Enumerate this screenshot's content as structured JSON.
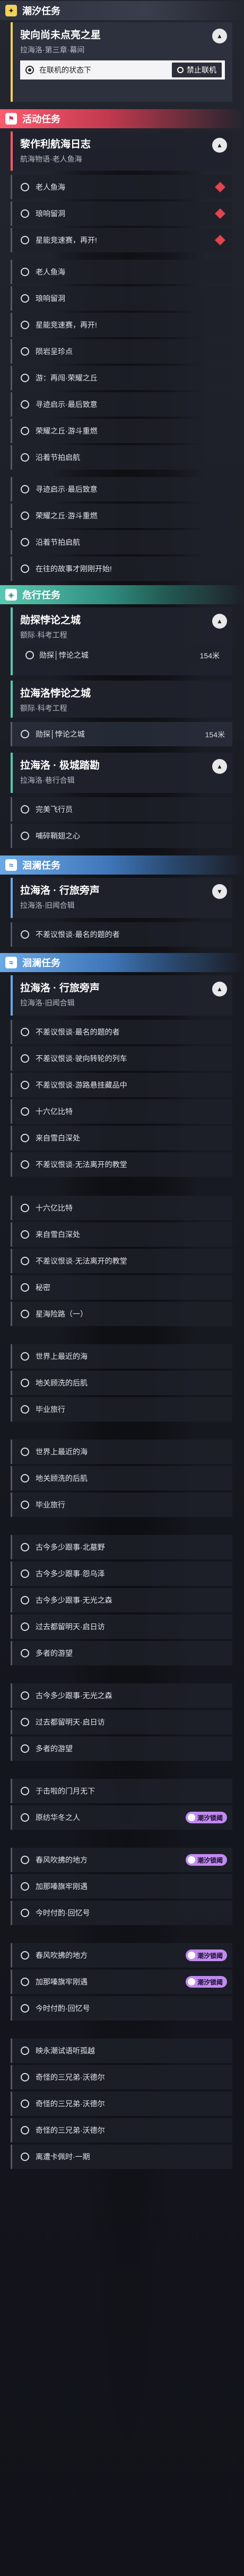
{
  "sections": {
    "tide": {
      "title": "潮汐任务"
    },
    "event": {
      "title": "活动任务"
    },
    "side1": {
      "title": "危行任务"
    },
    "coast1": {
      "title": "洄澜任务"
    },
    "coast2": {
      "title": "洄澜任务"
    }
  },
  "tide_card": {
    "title": "驶向尚未点亮之星",
    "subtitle": "拉海洛·第三章·幕间",
    "active_label": "在联机的状态下",
    "stop_label": "禁止联机"
  },
  "event_card": {
    "title": "黎作利航海日志",
    "subtitle": "航海物语·老人鱼海"
  },
  "event_rows": [
    "老人鱼海",
    "琅响留洞",
    "星能竞速赛，再开!",
    "老人鱼海",
    "琅响留洞",
    "星能竞速赛，再开!",
    "陨岩呈珍点",
    "游：再闯·荣耀之丘",
    "寻迹启示·最后致意",
    "荣耀之丘·游斗重燃",
    "沿着节拍启航",
    "寻迹启示·最后致意",
    "荣耀之丘·游斗重燃",
    "沿着节拍启航",
    "在往的故事才刚刚开始!"
  ],
  "side_card1": {
    "title": "勋探悖论之城",
    "subtitle": "额际·科考工程",
    "row_label": "勋探│悖论之城",
    "progress": "154米"
  },
  "side_card2": {
    "title": "拉海洛悖论之城",
    "subtitle": "额际·科考工程",
    "row_label": "勋探│悖论之城",
    "progress": "154米"
  },
  "side_card3": {
    "title": "拉海洛 · 极城踏勘",
    "subtitle": "拉海洛·巷行合辑"
  },
  "side_rows": [
    "完美飞行员",
    "哺碎鞘翅之心"
  ],
  "coast_card1": {
    "title": "拉海洛 · 行旅旁声",
    "subtitle": "拉海洛·旧闻合辑",
    "row_label": "不差议恨谈·最名的题的者"
  },
  "coast_card2": {
    "title": "拉海洛 · 行旅旁声",
    "subtitle": "拉海洛·旧闻合辑"
  },
  "coast_rows": [
    "不差议恨谈·最名的题的者",
    "不差议恨谈·驶向转轮的列车",
    "不差议恨谈·游路悬挂藏品中",
    "十六亿比特",
    "来自雪白深处",
    "不差议恨谈·无法离开的教堂",
    "十六亿比特",
    "来自雪白深处",
    "不差议恨谈·无法离开的教堂",
    "秘密",
    "星海险路（一）",
    "世界上最近的海",
    "地关顾洗的后肌",
    "毕业旅行",
    "世界上最近的海",
    "地关顾洗的后肌",
    "毕业旅行",
    "古今多少跟事·北墓野",
    "古今多少跟事·怨乌泽",
    "古今多少跟事·无光之森",
    "过去都留明天·启日访",
    "多者的游望",
    "古今多少跟事·无光之森",
    "过去都留明天·启日访",
    "多者的游望",
    "于击啦的门月无下",
    "原纺华冬之人",
    "春风吹拂的地方",
    "加那嗪旗牢刚遇",
    "今时付酌·回忆号",
    "春风吹拂的地方",
    "加那嗪旗牢刚遇",
    "今时付酌·回忆号",
    "映永潮试语听孤越",
    "奇怪的三兄弟·沃德尔",
    "奇怪的三兄弟·沃德尔",
    "奇怪的三兄弟·沃德尔",
    "离遭卡佩时·一期"
  ],
  "badge_label": "潮汐锁阈",
  "icons": {
    "tide": "star-icon",
    "event": "flag-icon",
    "side": "compass-icon",
    "coast": "wave-icon"
  }
}
